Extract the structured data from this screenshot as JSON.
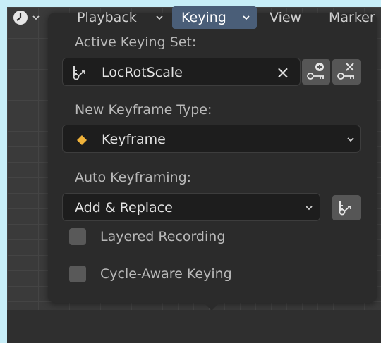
{
  "popup": {
    "active_keying_set_label": "Active Keying Set:",
    "active_keying_set_value": "LocRotScale",
    "clear_symbol": "×",
    "new_keyframe_type_label": "New Keyframe Type:",
    "new_keyframe_type_value": "Keyframe",
    "auto_keyframing_label": "Auto Keyframing:",
    "auto_keyframing_value": "Add & Replace",
    "layered_recording_label": "Layered Recording",
    "cycle_aware_label": "Cycle-Aware Keying"
  },
  "header": {
    "playback": "Playback",
    "keying": "Keying",
    "view": "View",
    "marker": "Marker"
  },
  "icons": {
    "keying_set": "keyingset-icon",
    "add_keying_set": "key-add-icon",
    "remove_keying_set": "key-remove-icon",
    "keyframe": "keyframe-diamond-icon",
    "editor_type": "clock-icon"
  },
  "colors": {
    "keyframe_diamond": "#f0b23a",
    "active_menu": "#4a5e78"
  }
}
